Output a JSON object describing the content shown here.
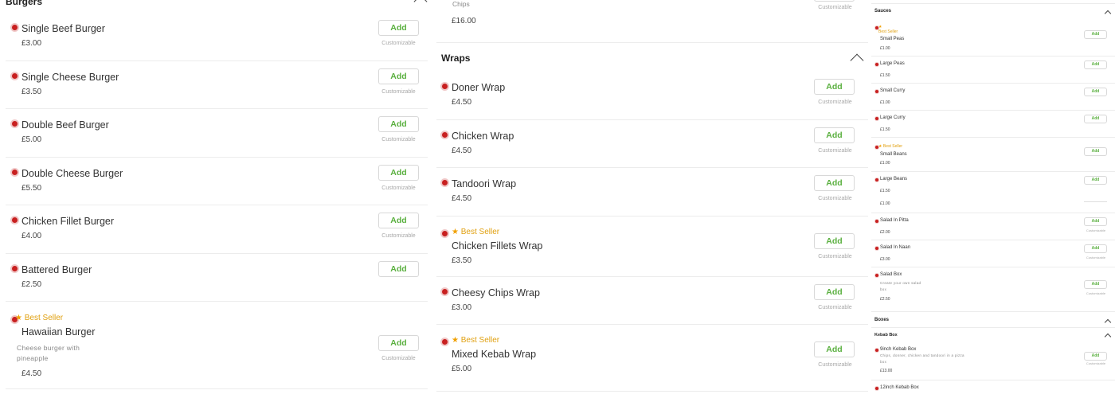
{
  "burgers": {
    "title": "Burgers",
    "items": [
      {
        "name": "Single Beef Burger",
        "price": "£3.00",
        "add": "Add",
        "note": "Customizable"
      },
      {
        "name": "Single Cheese Burger",
        "price": "£3.50",
        "add": "Add",
        "note": "Customizable"
      },
      {
        "name": "Double Beef Burger",
        "price": "£5.00",
        "add": "Add",
        "note": "Customizable"
      },
      {
        "name": "Double Cheese Burger",
        "price": "£5.50",
        "add": "Add",
        "note": "Customizable"
      },
      {
        "name": "Chicken Fillet Burger",
        "price": "£4.00",
        "add": "Add",
        "note": "Customizable"
      },
      {
        "name": "Battered Burger",
        "price": "£2.50",
        "add": "Add"
      },
      {
        "badge": "Best Seller",
        "name": "Hawaiian Burger",
        "desc": "Cheese burger with pineapple",
        "price": "£4.50",
        "add": "Add",
        "note": "Customizable"
      }
    ]
  },
  "wraps_prev": {
    "name": "Chips",
    "price": "£16.00",
    "note": "Customizable"
  },
  "wraps": {
    "title": "Wraps",
    "items": [
      {
        "name": "Doner Wrap",
        "price": "£4.50",
        "add": "Add",
        "note": "Customizable"
      },
      {
        "name": "Chicken Wrap",
        "price": "£4.50",
        "add": "Add",
        "note": "Customizable"
      },
      {
        "name": "Tandoori Wrap",
        "price": "£4.50",
        "add": "Add",
        "note": "Customizable"
      },
      {
        "badge": "Best Seller",
        "name": "Chicken Fillets Wrap",
        "price": "£3.50",
        "add": "Add",
        "note": "Customizable"
      },
      {
        "name": "Cheesy Chips Wrap",
        "price": "£3.00",
        "add": "Add",
        "note": "Customizable"
      },
      {
        "badge": "Best Seller",
        "name": "Mixed Kebab Wrap",
        "price": "£5.00",
        "add": "Add",
        "note": "Customizable"
      }
    ]
  },
  "sauces": {
    "title": "Sauces",
    "items": [
      {
        "badge": "Best Seller",
        "name": "Small Peas",
        "price": "£1.00",
        "add": "Add"
      },
      {
        "name": "Large Peas",
        "price": "£1.50",
        "add": "Add"
      },
      {
        "name": "Small Curry",
        "price": "£1.00",
        "add": "Add"
      },
      {
        "name": "Large Curry",
        "price": "£1.50",
        "add": "Add"
      },
      {
        "badge": "Best Seller",
        "name": "Small Beans",
        "price": "£1.00",
        "add": "Add"
      },
      {
        "name": "Large Beans",
        "price": "£1.50",
        "price2": "£1.00",
        "add": "Add"
      },
      {
        "name": "Salad In Pitta",
        "price": "£2.00",
        "add": "Add",
        "note": "Customizable"
      },
      {
        "name": "Salad In Naan",
        "price": "£3.00",
        "add": "Add",
        "note": "Customizable"
      },
      {
        "name": "Salad Box",
        "desc": "Create your own salad box",
        "price": "£2.50",
        "add": "Add",
        "note": "Customizable"
      }
    ]
  },
  "boxes": {
    "title": "Boxes",
    "sub_title": "Kebab Box",
    "items": [
      {
        "name": "9inch Kebab Box",
        "desc": "Chips, donner, chicken and tandoori in a pizza box",
        "price": "£13.00",
        "add": "Add",
        "note": "Customizable"
      },
      {
        "name": "12inch Kebab Box"
      }
    ]
  }
}
